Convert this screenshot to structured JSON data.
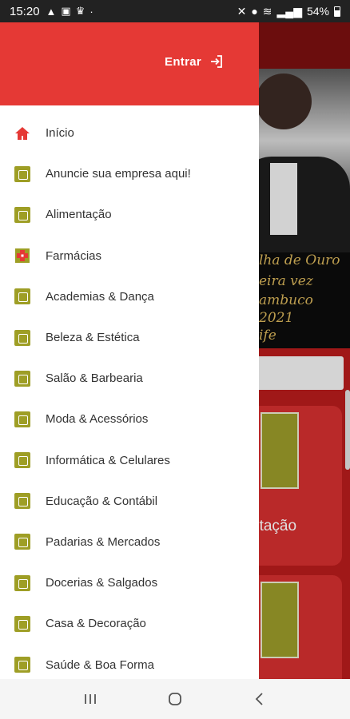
{
  "status_bar": {
    "time": "15:20",
    "battery": "54%",
    "left_icons": [
      "navigation-icon",
      "image-icon",
      "crown-icon",
      "dot-icon"
    ],
    "right_icons": [
      "mute-icon",
      "location-icon",
      "wifi-icon",
      "signal-icon",
      "battery-icon"
    ]
  },
  "drawer": {
    "header_color": "#e53935",
    "login_label": "Entrar",
    "items": [
      {
        "label": "Início",
        "icon": "home-icon"
      },
      {
        "label": "Anuncie sua empresa aqui!",
        "icon": "advertise-icon"
      },
      {
        "label": "Alimentação",
        "icon": "food-icon"
      },
      {
        "label": "Farmácias",
        "icon": "pharmacy-icon"
      },
      {
        "label": "Academias & Dança",
        "icon": "gym-icon"
      },
      {
        "label": "Beleza & Estética",
        "icon": "beauty-icon"
      },
      {
        "label": "Salão & Barbearia",
        "icon": "salon-icon"
      },
      {
        "label": "Moda & Acessórios",
        "icon": "fashion-icon"
      },
      {
        "label": "Informática & Celulares",
        "icon": "computer-icon"
      },
      {
        "label": "Educação & Contábil",
        "icon": "education-icon"
      },
      {
        "label": "Padarias & Mercados",
        "icon": "bakery-icon"
      },
      {
        "label": "Docerias & Salgados",
        "icon": "sweets-icon"
      },
      {
        "label": "Casa & Decoração",
        "icon": "home-decor-icon"
      },
      {
        "label": "Saúde & Boa Forma",
        "icon": "health-icon"
      }
    ]
  },
  "background": {
    "banner_lines": [
      "lha de Ouro",
      "eira vez",
      "ambuco",
      "2021",
      "ife"
    ],
    "card_label": "ntação"
  },
  "colors": {
    "accent": "#e53935",
    "icon_olive": "#9e9e25",
    "home_icon": "#e53935"
  },
  "nav_bar": {
    "buttons": [
      "recent-apps-icon",
      "home-button-icon",
      "back-icon"
    ]
  }
}
